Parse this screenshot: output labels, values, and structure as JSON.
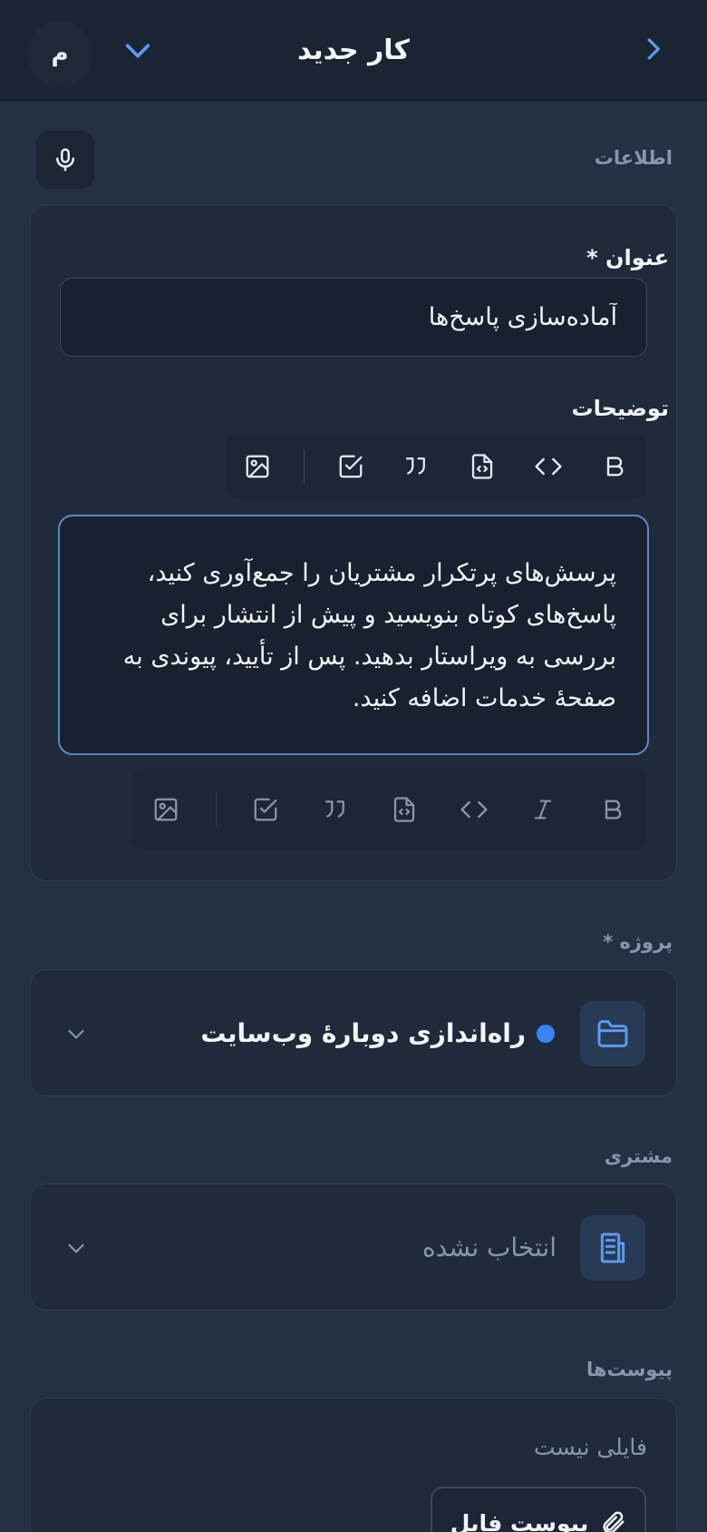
{
  "header": {
    "title": "کار جدید",
    "avatar_initial": "م"
  },
  "sections": {
    "info_label": "اطلاعات",
    "project_label": "پروژه *",
    "customer_label": "مشتری",
    "attachments_label": "پیوست‌ها"
  },
  "form": {
    "title_label": "عنوان *",
    "title_value": "آماده‌سازی پاسخ‌ها",
    "description_label": "توضیحات",
    "description_value": "پرسش‌های پرتکرار مشتریان را جمع‌آوری کنید، پاسخ‌های کوتاه بنویسید و پیش از انتشار برای بررسی به ویراستار بدهید. پس از تأیید، پیوندی به صفحهٔ خدمات اضافه کنید."
  },
  "project": {
    "selected": "راه‌اندازی دوبارهٔ وب‌سایت",
    "dot_color": "#3b82f6"
  },
  "customer": {
    "selected": "انتخاب نشده"
  },
  "attachments": {
    "empty_text": "فایلی نیست",
    "button_label": "پیوست فایل"
  },
  "colors": {
    "accent": "#5b9bef",
    "background": "#243044",
    "header": "#1b2432"
  }
}
